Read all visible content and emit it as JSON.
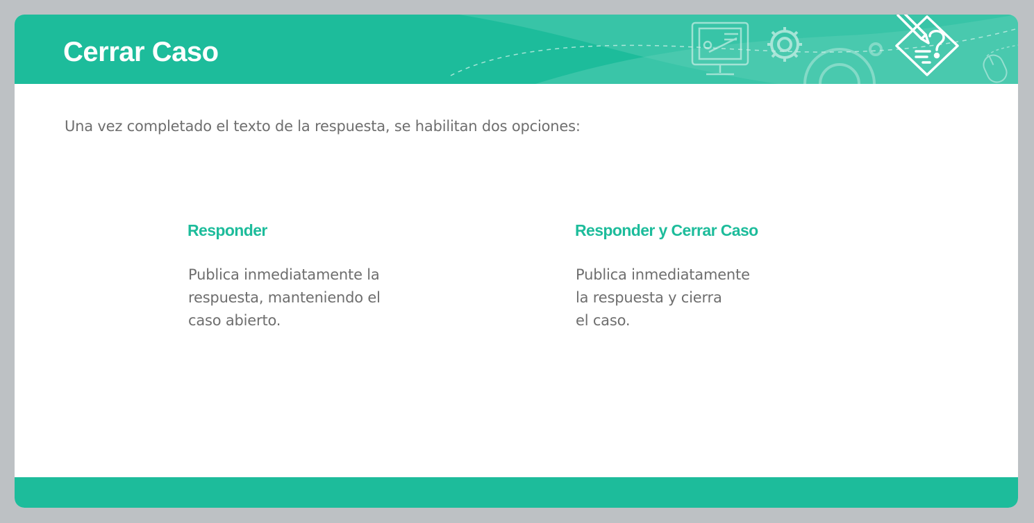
{
  "header": {
    "title": "Cerrar Caso",
    "icons": [
      "computer-presentation-icon",
      "gear-icon",
      "edit-question-icon",
      "mouse-icon"
    ]
  },
  "intro_text": "Una vez completado el texto de la respuesta, se habilitan dos opciones:",
  "options": [
    {
      "title": "Responder",
      "description": "Publica inmediatamente la\nrespuesta, manteniendo el\ncaso abierto."
    },
    {
      "title": "Responder y Cerrar Caso",
      "description": "Publica inmediatamente\nla respuesta y cierra\nel caso."
    }
  ],
  "colors": {
    "accent": "#1dbc9b",
    "background": "#bdc1c4",
    "card": "#ffffff",
    "text": "#6e6e6e"
  }
}
